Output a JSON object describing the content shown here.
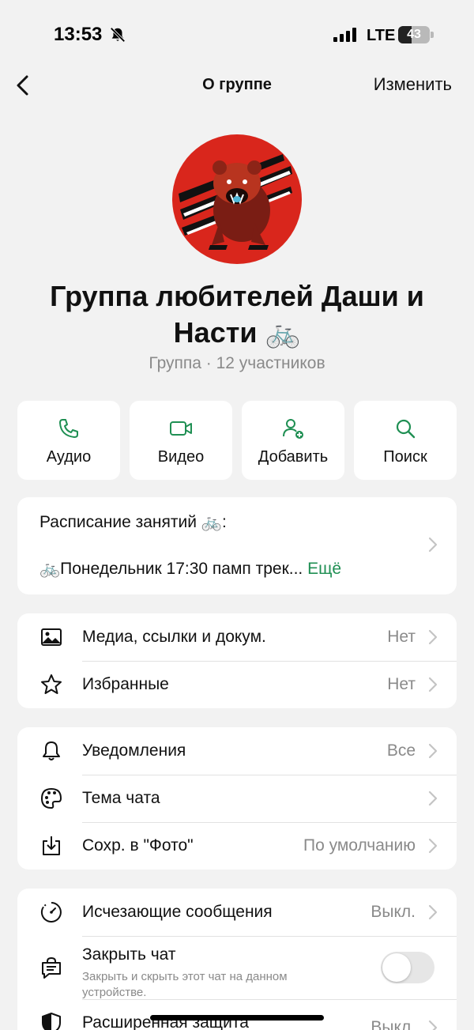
{
  "status_bar": {
    "time": "13:53",
    "network": "LTE",
    "battery_level": "43",
    "battery_fraction": 0.43
  },
  "nav": {
    "title": "О группе",
    "edit_label": "Изменить"
  },
  "group": {
    "name": "Группа любителей Даши и Насти 🚲",
    "meta": "Группа · 12 участников"
  },
  "actions": [
    {
      "label": "Аудио",
      "icon": "phone-icon"
    },
    {
      "label": "Видео",
      "icon": "video-icon"
    },
    {
      "label": "Добавить",
      "icon": "add-user-icon"
    },
    {
      "label": "Поиск",
      "icon": "search-icon"
    }
  ],
  "description": {
    "line1": "Расписание занятий 🚲:",
    "line2": "🚲Понедельник 17:30 памп трек... ",
    "more_label": "Ещё"
  },
  "media_section": {
    "items": [
      {
        "label": "Медиа, ссылки и докум.",
        "value": "Нет",
        "icon": "image-icon"
      },
      {
        "label": "Избранные",
        "value": "Нет",
        "icon": "star-icon"
      }
    ]
  },
  "settings_section": {
    "items": [
      {
        "label": "Уведомления",
        "value": "Все",
        "icon": "bell-icon"
      },
      {
        "label": "Тема чата",
        "value": "",
        "icon": "palette-icon"
      },
      {
        "label": "Сохр. в \"Фото\"",
        "value": "По умолчанию",
        "icon": "save-download-icon"
      }
    ]
  },
  "privacy_section": {
    "disappearing": {
      "label": "Исчезающие сообщения",
      "value": "Выкл.",
      "icon": "timer-icon"
    },
    "lock_chat": {
      "label": "Закрыть чат",
      "sublabel": "Закрыть и скрыть этот чат на данном устройстве.",
      "icon": "lock-chat-icon",
      "enabled": false
    },
    "advanced": {
      "label": "Расширенная защита",
      "value": "Выкл.",
      "icon": "shield-icon"
    }
  },
  "colors": {
    "accent": "#1f8f53",
    "background": "#f2f2f2",
    "avatar_bg": "#d9261c"
  }
}
